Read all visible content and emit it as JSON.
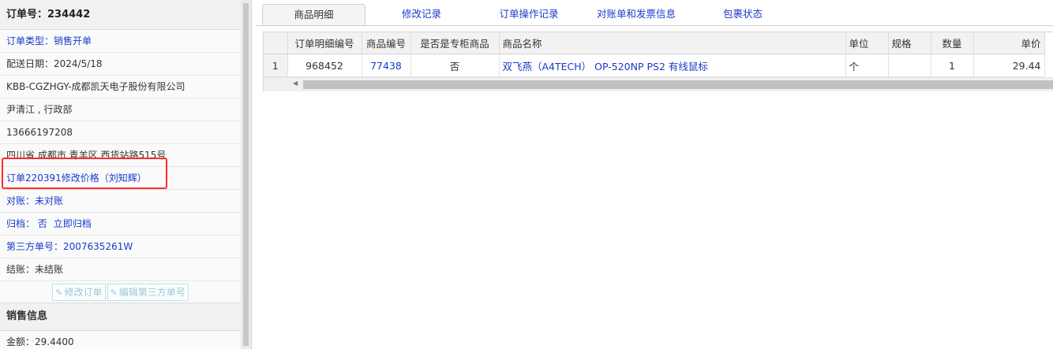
{
  "order": {
    "title": "订单号：234442",
    "type_label": "订单类型：销售开单",
    "delivery_date": "配送日期：2024/5/18",
    "customer": "KBB-CGZHGY-成都凯天电子股份有限公司",
    "contact": "尹清江 , 行政部",
    "phone": "13666197208",
    "address": "四川省 成都市 青羊区 西货站路515号",
    "note": "订单220391修改价格（刘知辉）",
    "reconcile_label": "对账：",
    "reconcile_value": "未对账",
    "archive_label": "归档：",
    "archive_value": "否",
    "archive_link": "立即归档",
    "third_party": "第三方单号：2007635261W",
    "settle": "结账：未结账",
    "btn_edit_order": "修改订单",
    "btn_edit_third": "编辑第三方单号"
  },
  "sales": {
    "title": "销售信息",
    "amount": "金额：29.4400"
  },
  "tabs": [
    "商品明细",
    "修改记录",
    "订单操作记录",
    "对账单和发票信息",
    "包裹状态"
  ],
  "grid": {
    "columns": [
      "订单明细编号",
      "商品编号",
      "是否是专柜商品",
      "商品名称",
      "单位",
      "规格",
      "数量",
      "单价"
    ],
    "rows": [
      {
        "row_no": "1",
        "detail_id": "968452",
        "product_id": "77438",
        "is_counter": "否",
        "name": "双飞燕（A4TECH） OP-520NP PS2 有线鼠标",
        "unit": "个",
        "spec": "",
        "qty": "1",
        "price": "29.44"
      }
    ]
  },
  "colors": {
    "link": "#1a3acb",
    "highlight": "#ff2b2b"
  }
}
